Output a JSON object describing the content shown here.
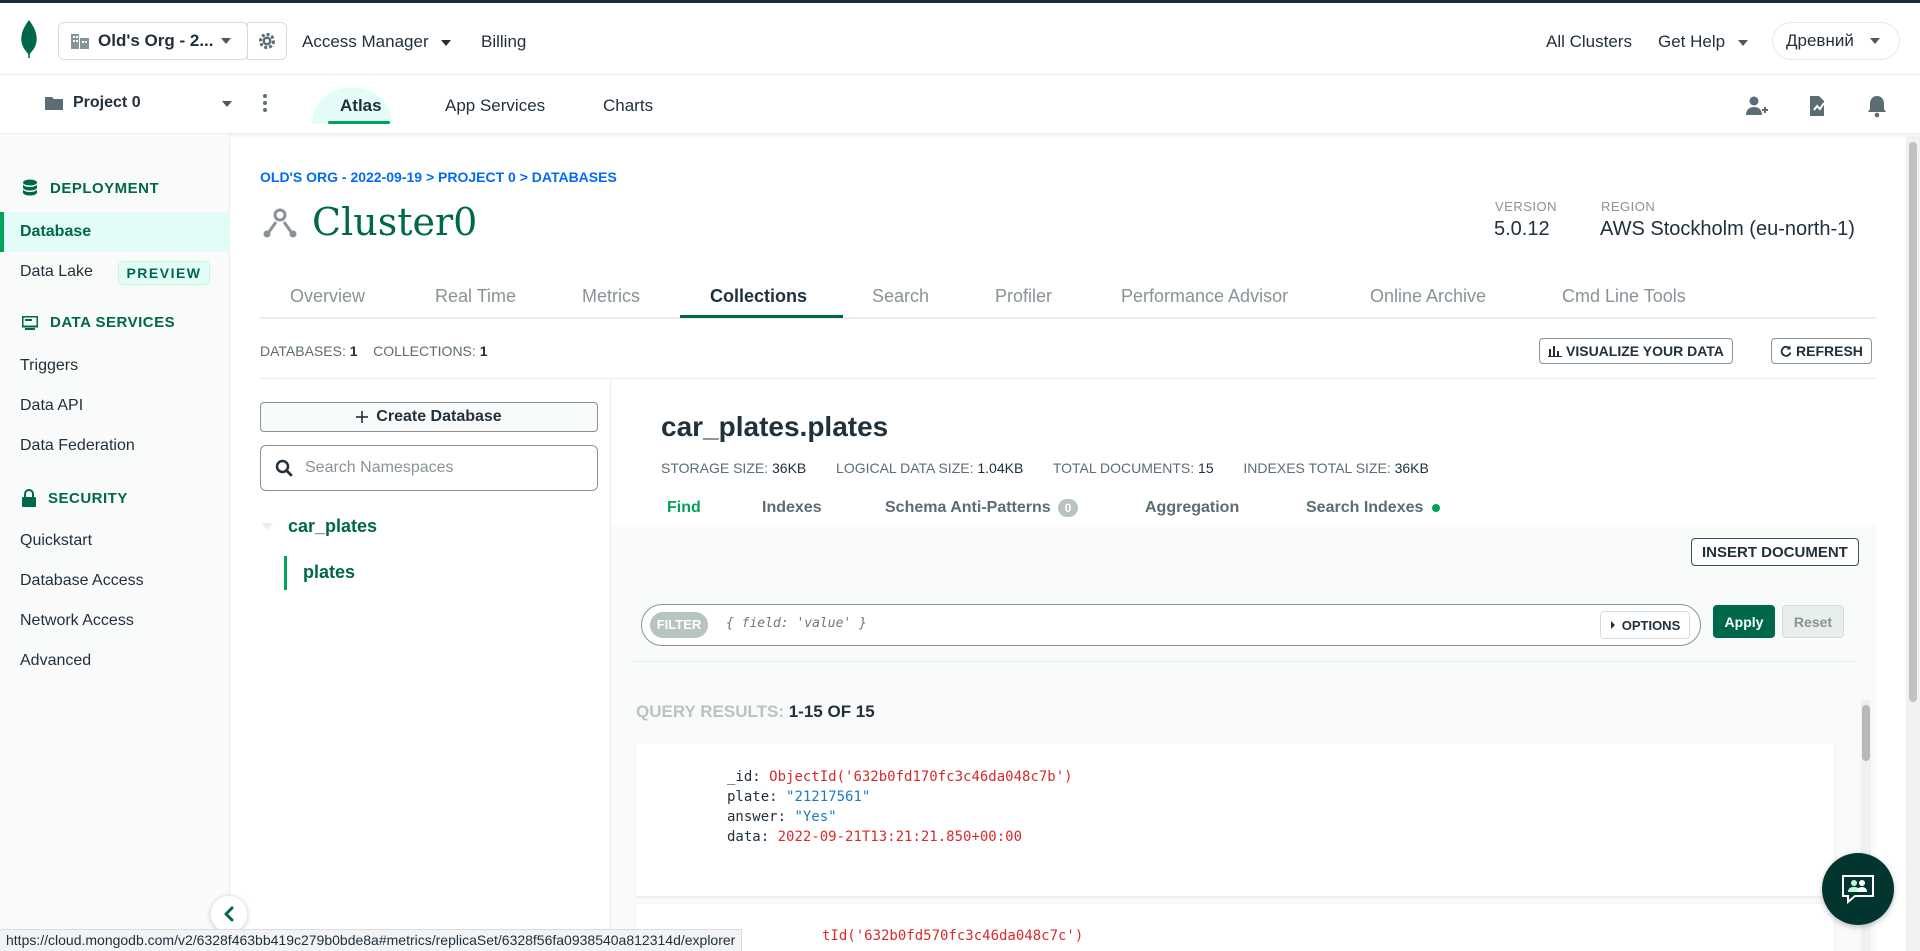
{
  "header": {
    "org_name": "Old's Org - 2...",
    "access_manager": "Access Manager",
    "billing": "Billing",
    "all_clusters": "All Clusters",
    "get_help": "Get Help",
    "user": "Древний"
  },
  "subheader": {
    "project": "Project 0",
    "tabs": [
      "Atlas",
      "App Services",
      "Charts"
    ],
    "active_tab": "Atlas"
  },
  "sidebar": {
    "deployment_title": "DEPLOYMENT",
    "database": "Database",
    "data_lake": "Data Lake",
    "preview_badge": "PREVIEW",
    "data_services_title": "DATA SERVICES",
    "triggers": "Triggers",
    "data_api": "Data API",
    "data_federation": "Data Federation",
    "security_title": "SECURITY",
    "quickstart": "Quickstart",
    "database_access": "Database Access",
    "network_access": "Network Access",
    "advanced": "Advanced"
  },
  "cluster": {
    "breadcrumb": "OLD'S ORG - 2022-09-19 > PROJECT 0 > DATABASES",
    "name": "Cluster0",
    "version_label": "VERSION",
    "version": "5.0.12",
    "region_label": "REGION",
    "region": "AWS Stockholm (eu-north-1)",
    "tabs": [
      "Overview",
      "Real Time",
      "Metrics",
      "Collections",
      "Search",
      "Profiler",
      "Performance Advisor",
      "Online Archive",
      "Cmd Line Tools"
    ],
    "active_tab": "Collections"
  },
  "counts": {
    "databases_label": "DATABASES:",
    "databases": "1",
    "collections_label": "COLLECTIONS:",
    "collections": "1",
    "visualize": "VISUALIZE YOUR DATA",
    "refresh": "REFRESH"
  },
  "namespaces": {
    "create_db": "Create Database",
    "search_placeholder": "Search Namespaces",
    "database": "car_plates",
    "collection": "plates"
  },
  "collection": {
    "title": "car_plates.plates",
    "storage_size_label": "STORAGE SIZE:",
    "storage_size": "36KB",
    "logical_size_label": "LOGICAL DATA SIZE:",
    "logical_size": "1.04KB",
    "total_docs_label": "TOTAL DOCUMENTS:",
    "total_docs": "15",
    "indexes_size_label": "INDEXES TOTAL SIZE:",
    "indexes_size": "36KB",
    "subtabs": [
      "Find",
      "Indexes",
      "Schema Anti-Patterns",
      "Aggregation",
      "Search Indexes"
    ],
    "anti_patterns_count": "0",
    "active_subtab": "Find"
  },
  "find": {
    "insert_document": "INSERT DOCUMENT",
    "filter_label": "FILTER",
    "filter_placeholder": "{ field: 'value' }",
    "options": "OPTIONS",
    "apply": "Apply",
    "reset": "Reset",
    "results_label": "QUERY RESULTS:",
    "results_range": "1-15 OF 15"
  },
  "documents": [
    {
      "id_key": "_id:",
      "id_val": "ObjectId('632b0fd170fc3c46da048c7b')",
      "plate_key": "plate:",
      "plate_val": "\"21217561\"",
      "answer_key": "answer:",
      "answer_val": "\"Yes\"",
      "data_key": "data:",
      "data_val": "2022-09-21T13:21:21.850+00:00"
    },
    {
      "id_val_partial": "tId('632b0fd570fc3c46da048c7c')"
    }
  ],
  "status_bar": {
    "url": "https://cloud.mongodb.com/v2/6328f463bb419c279b0bde8a#metrics/replicaSet/6328f56fa0938540a812314d/explorer"
  },
  "colors": {
    "brand_green": "#00684a",
    "accent_green": "#00a35c",
    "link_blue": "#016bf8",
    "string_blue": "#1a79c2",
    "value_red": "#d82b2b"
  }
}
